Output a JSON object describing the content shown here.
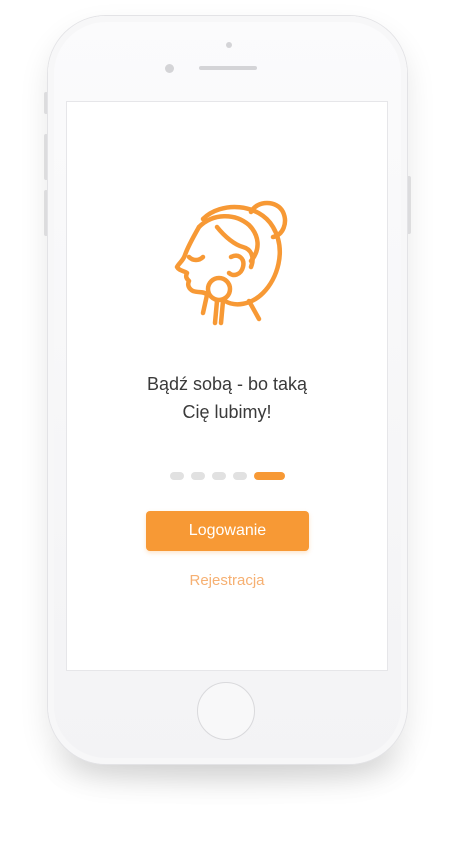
{
  "onboarding": {
    "headline_line1": "Bądź sobą - bo taką",
    "headline_line2": "Cię lubimy!",
    "login_label": "Logowanie",
    "register_label": "Rejestracja",
    "page_indicator": {
      "total": 5,
      "current": 5
    },
    "illustration_icon": "woman-face-beauty-icon"
  },
  "colors": {
    "accent": "#f79935",
    "accent_light": "#f6b072",
    "text": "#3a3a3a",
    "dot_inactive": "#e1e1e1"
  }
}
